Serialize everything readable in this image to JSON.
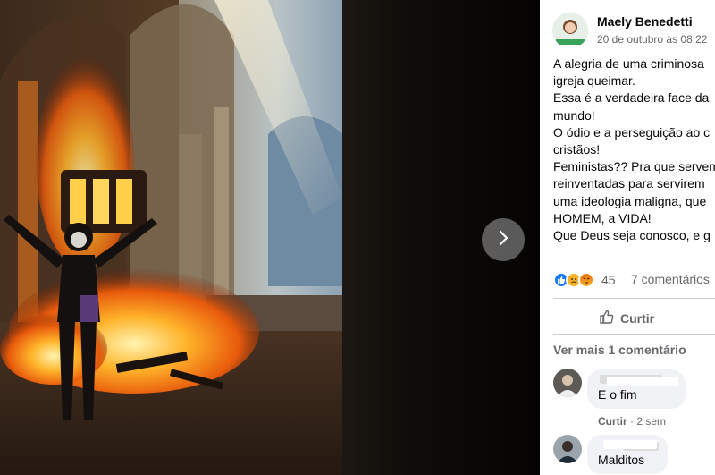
{
  "post": {
    "author": "Maely Benedetti",
    "timestamp": "20 de outubro às 08:22",
    "text_lines": [
      "A alegria de uma criminosa",
      "igreja queimar.",
      "Essa é a verdadeira face da",
      "mundo!",
      "O ódio e a perseguição ao c",
      "cristãos!",
      "Feministas?? Pra que servem",
      "reinventadas para servirem",
      "uma ideologia maligna, que",
      "HOMEM, a VIDA!",
      "Que Deus seja conosco, e g"
    ],
    "reaction_count": "45",
    "comment_count": "7 comentários",
    "share_label": "Curtir",
    "more_comments_label": "Ver mais 1 comentário"
  },
  "comments": [
    {
      "text": "E o fim",
      "action": "Curtir",
      "age": "· 2 sem"
    },
    {
      "text": "Malditos"
    }
  ],
  "colors": {
    "reaction_like": "#1877f2",
    "reaction_sad": "#f7b125",
    "secondary_text": "#65676b",
    "bubble_bg": "#f0f2f5"
  },
  "icons": {
    "next": "chevron-right-icon",
    "share": "thumbs-up-icon",
    "reactions": [
      "like-icon",
      "sad-icon",
      "angry-icon"
    ]
  }
}
